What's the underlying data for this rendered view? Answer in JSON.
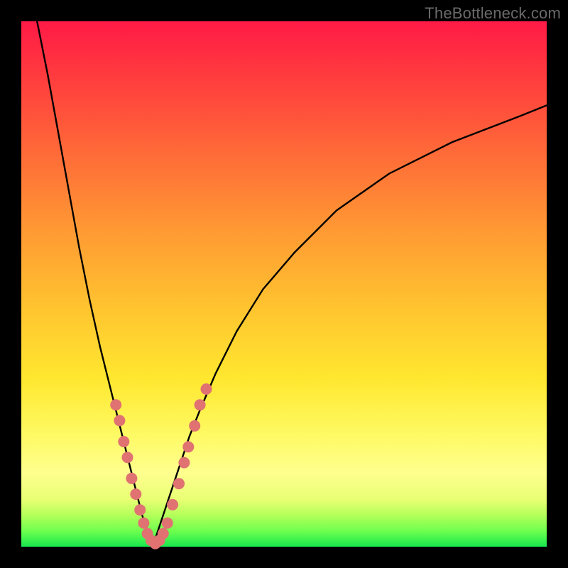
{
  "watermark": "TheBottleneck.com",
  "colors": {
    "frame": "#000000",
    "gradient_top": "#ff1a46",
    "gradient_bottom": "#17e84f",
    "curve": "#000000",
    "dots": "#e07272"
  },
  "chart_data": {
    "type": "line",
    "title": "",
    "xlabel": "",
    "ylabel": "",
    "xlim": [
      0,
      100
    ],
    "ylim": [
      0,
      100
    ],
    "grid": false,
    "legend": false,
    "note": "Two curves forming a V with minimum near x≈25. No axis ticks or labels are shown. Points below are sampled along the curves; values are percentages of the plot area (x left→right, y bottom→top).",
    "series": [
      {
        "name": "left-branch",
        "x": [
          3,
          5,
          7,
          9,
          11,
          13,
          15,
          17,
          19,
          20,
          21,
          22,
          23,
          24,
          25
        ],
        "y": [
          100,
          90,
          79,
          68,
          57,
          47,
          38,
          30,
          22,
          18,
          14,
          10,
          6,
          3,
          0
        ]
      },
      {
        "name": "right-branch",
        "x": [
          25,
          26,
          27,
          28,
          29,
          30,
          32,
          34,
          37,
          41,
          46,
          52,
          60,
          70,
          82,
          95,
          100
        ],
        "y": [
          0,
          3,
          6,
          9,
          12,
          15,
          21,
          26,
          33,
          41,
          49,
          56,
          64,
          71,
          77,
          82,
          84
        ]
      }
    ],
    "scatter_overlay": {
      "name": "highlighted-points",
      "note": "Salmon dots clustered on the lower portion of both branches, roughly y ∈ [0, 30].",
      "points": [
        {
          "x": 18.0,
          "y": 27
        },
        {
          "x": 18.7,
          "y": 24
        },
        {
          "x": 19.5,
          "y": 20
        },
        {
          "x": 20.2,
          "y": 17
        },
        {
          "x": 21.0,
          "y": 13
        },
        {
          "x": 21.8,
          "y": 10
        },
        {
          "x": 22.6,
          "y": 7
        },
        {
          "x": 23.3,
          "y": 4.5
        },
        {
          "x": 24.0,
          "y": 2.5
        },
        {
          "x": 24.7,
          "y": 1.2
        },
        {
          "x": 25.5,
          "y": 0.6
        },
        {
          "x": 26.3,
          "y": 1.2
        },
        {
          "x": 27.0,
          "y": 2.5
        },
        {
          "x": 27.8,
          "y": 4.5
        },
        {
          "x": 28.8,
          "y": 8
        },
        {
          "x": 30.0,
          "y": 12
        },
        {
          "x": 31.0,
          "y": 16
        },
        {
          "x": 31.8,
          "y": 19
        },
        {
          "x": 33.0,
          "y": 23
        },
        {
          "x": 34.0,
          "y": 27
        },
        {
          "x": 35.2,
          "y": 30
        }
      ]
    }
  }
}
